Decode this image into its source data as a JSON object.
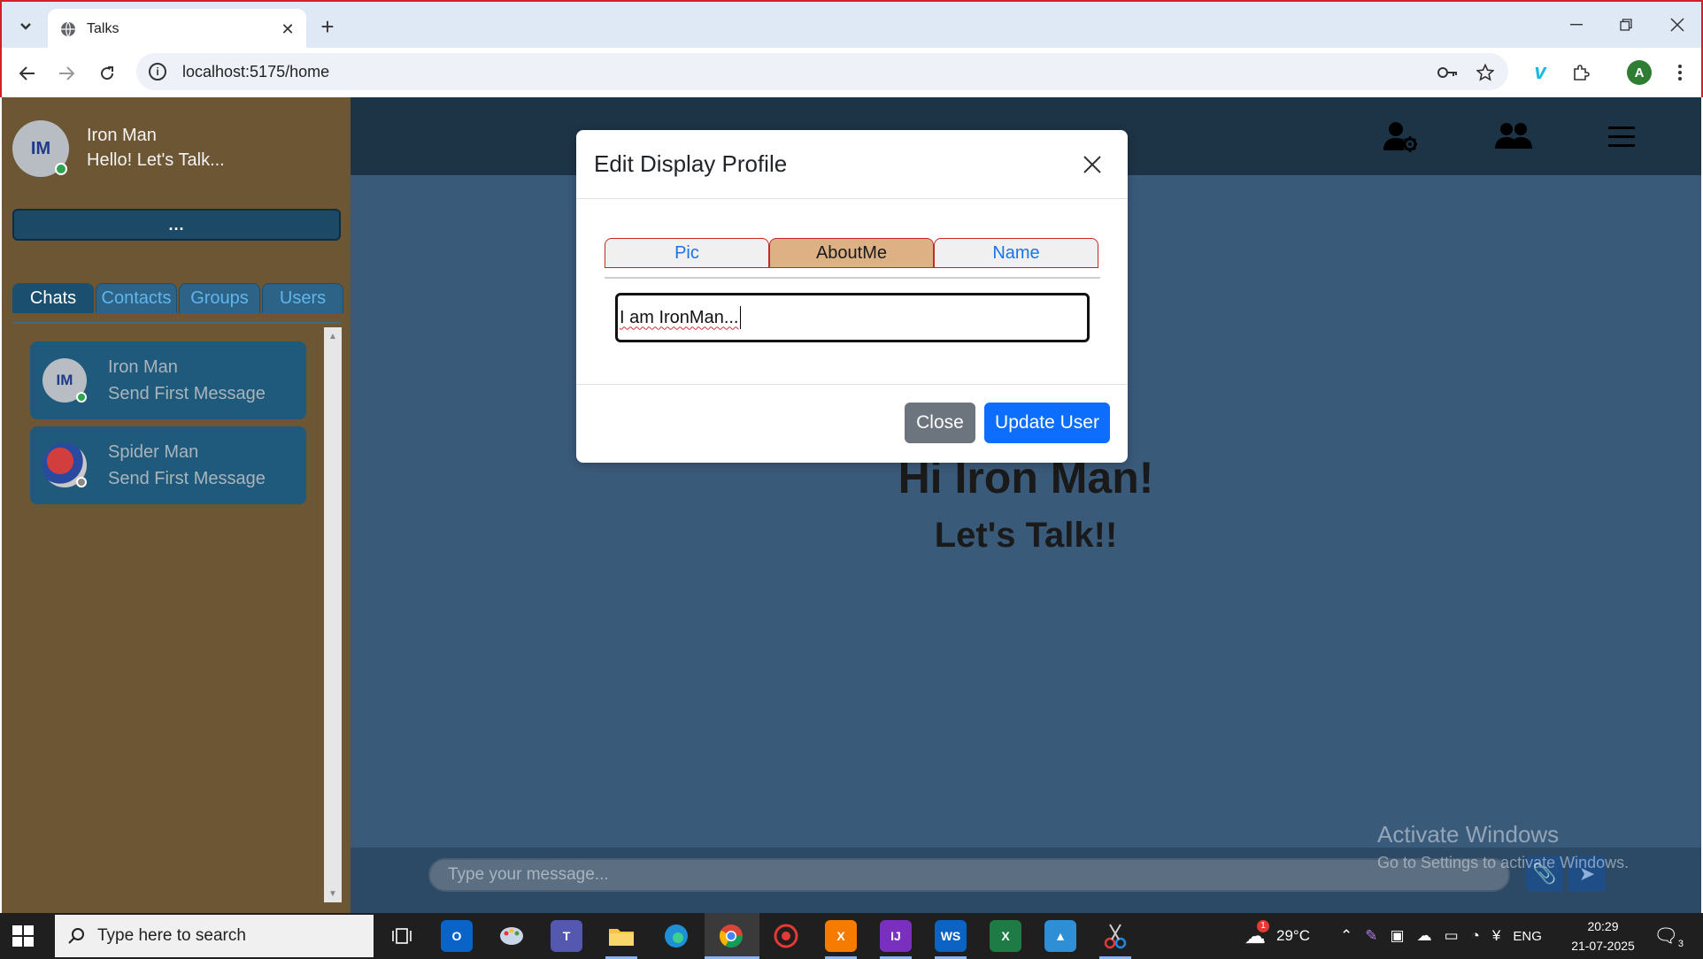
{
  "browser": {
    "tab_title": "Talks",
    "url": "localhost:5175/home",
    "profile_initial": "A"
  },
  "sidebar": {
    "me": {
      "initials": "IM",
      "name": "Iron Man",
      "status": "Hello! Let's Talk..."
    },
    "more_label": "...",
    "tabs": [
      {
        "label": "Chats",
        "active": true
      },
      {
        "label": "Contacts",
        "active": false
      },
      {
        "label": "Groups",
        "active": false
      },
      {
        "label": "Users",
        "active": false
      }
    ],
    "chats": [
      {
        "initials": "IM",
        "name": "Iron Man",
        "message": "Send First Message",
        "online": true
      },
      {
        "initials": "",
        "name": "Spider Man",
        "message": "Send First Message",
        "online": false
      }
    ]
  },
  "main": {
    "greeting": "Hi Iron Man!",
    "subgreeting": "Let's Talk!!",
    "message_placeholder": "Type your message..."
  },
  "modal": {
    "title": "Edit Display Profile",
    "tabs": [
      {
        "label": "Pic",
        "active": false
      },
      {
        "label": "AboutMe",
        "active": true
      },
      {
        "label": "Name",
        "active": false
      }
    ],
    "about_value": "I am IronMan...",
    "close_label": "Close",
    "update_label": "Update User"
  },
  "watermark": {
    "line1": "Activate Windows",
    "line2": "Go to Settings to activate Windows."
  },
  "taskbar": {
    "search_placeholder": "Type here to search",
    "temperature": "29°C",
    "language": "ENG",
    "time": "20:29",
    "date": "21-07-2025",
    "notification_count": "3",
    "weather_badge": "1"
  },
  "colors": {
    "sidebar_bg": "#6d5633",
    "main_bg": "#3a5a7a",
    "header_bg": "#1d3446",
    "active_modal_tab": "#deb184",
    "primary_button": "#0d6efd",
    "secondary_button": "#6c757d"
  }
}
